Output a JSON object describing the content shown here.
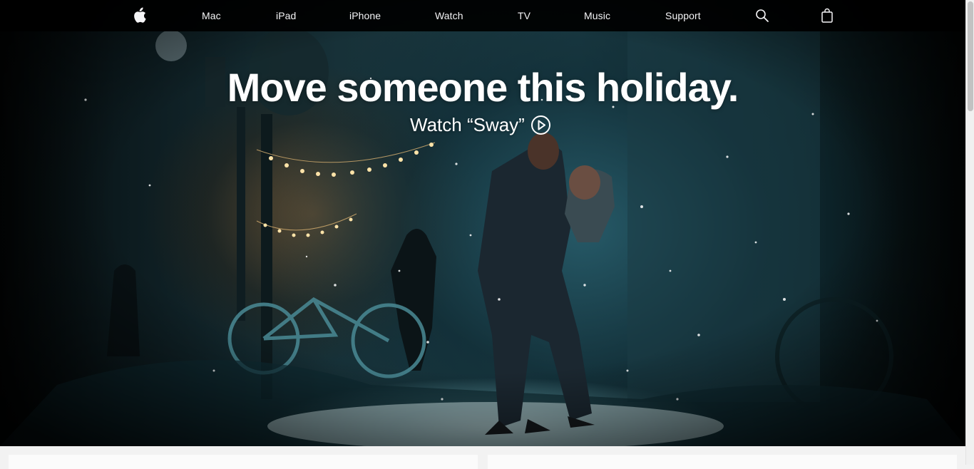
{
  "nav": {
    "logo_icon": "apple-logo-icon",
    "items": [
      {
        "label": "Mac"
      },
      {
        "label": "iPad"
      },
      {
        "label": "iPhone"
      },
      {
        "label": "Watch"
      },
      {
        "label": "TV"
      },
      {
        "label": "Music"
      },
      {
        "label": "Support"
      }
    ],
    "search_icon": "search-icon",
    "bag_icon": "shopping-bag-icon"
  },
  "hero": {
    "headline": "Move someone this holiday.",
    "cta_label": "Watch “Sway”",
    "cta_icon": "play-circle-icon"
  },
  "colors": {
    "nav_background": "#0b0b0b",
    "nav_text": "#f5f5f7",
    "hero_text": "#ffffff"
  }
}
